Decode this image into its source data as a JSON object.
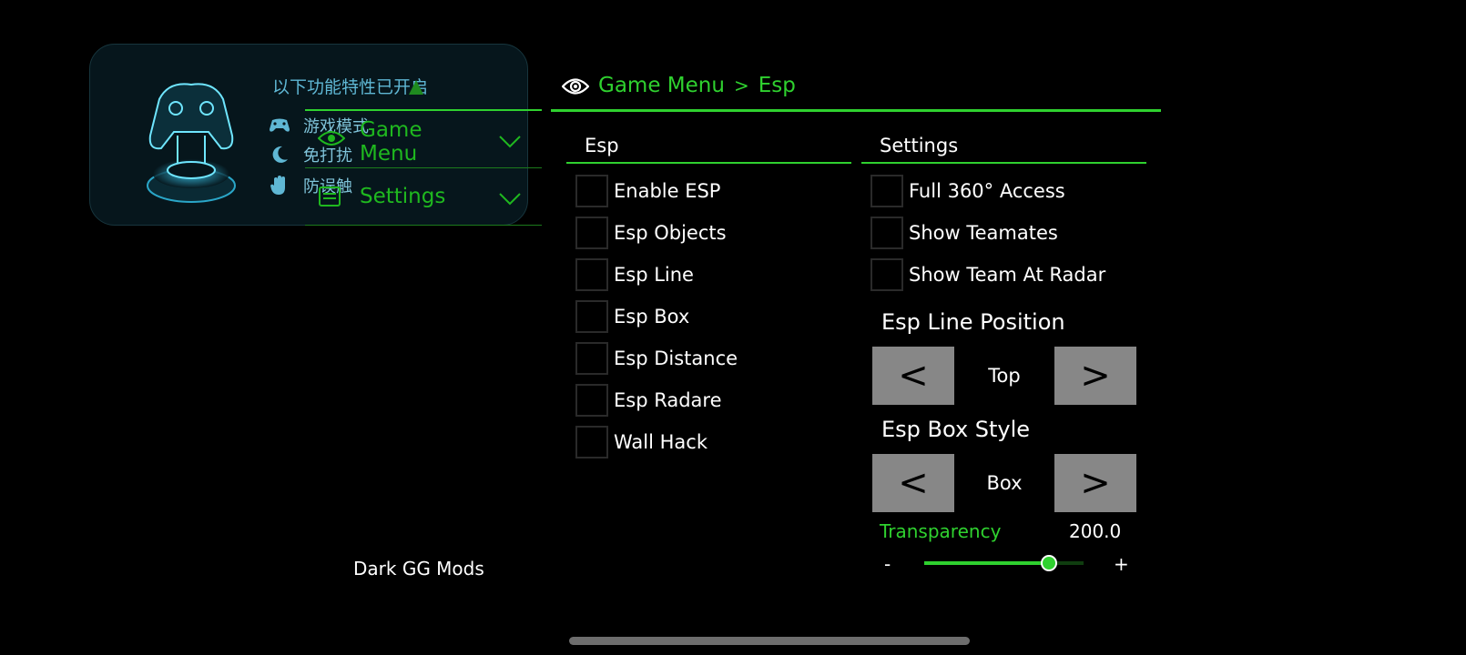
{
  "notification": {
    "title": "以下功能特性已开启",
    "features": [
      {
        "label": "游戏模式",
        "icon": "gamepad-icon"
      },
      {
        "label": "免打扰",
        "icon": "moon-icon"
      },
      {
        "label": "防误触",
        "icon": "hand-icon"
      }
    ]
  },
  "left_menu": {
    "items": [
      {
        "label": "Game Menu",
        "icon": "eye-icon"
      },
      {
        "label": "Settings",
        "icon": "settings-icon"
      }
    ]
  },
  "header": {
    "crumbs": [
      "Game Menu",
      "Esp"
    ],
    "separator": ">"
  },
  "esp_column": {
    "title": "Esp",
    "options": [
      {
        "label": "Enable ESP",
        "checked": false
      },
      {
        "label": "Esp Objects",
        "checked": false
      },
      {
        "label": "Esp Line",
        "checked": false
      },
      {
        "label": "Esp Box",
        "checked": false
      },
      {
        "label": "Esp Distance",
        "checked": false
      },
      {
        "label": "Esp Radare",
        "checked": false
      },
      {
        "label": "Wall Hack",
        "checked": false
      }
    ]
  },
  "settings_column": {
    "title": "Settings",
    "options": [
      {
        "label": "Full 360° Access",
        "checked": false
      },
      {
        "label": "Show Teamates",
        "checked": false
      },
      {
        "label": "Show Team At Radar",
        "checked": false
      }
    ],
    "line_position": {
      "title": "Esp Line Position",
      "value": "Top",
      "prev": "<",
      "next": ">"
    },
    "box_style": {
      "title": "Esp Box Style",
      "value": "Box",
      "prev": "<",
      "next": ">"
    },
    "transparency": {
      "label": "Transparency",
      "value": "200.0",
      "level": 0.78,
      "minus": "-",
      "plus": "+"
    }
  },
  "footer": {
    "brand": "Dark GG Mods"
  },
  "colors": {
    "accent": "#2fd12f",
    "notif_text": "#5fb7d4",
    "stepper_bg": "#878787",
    "background": "#000000"
  }
}
